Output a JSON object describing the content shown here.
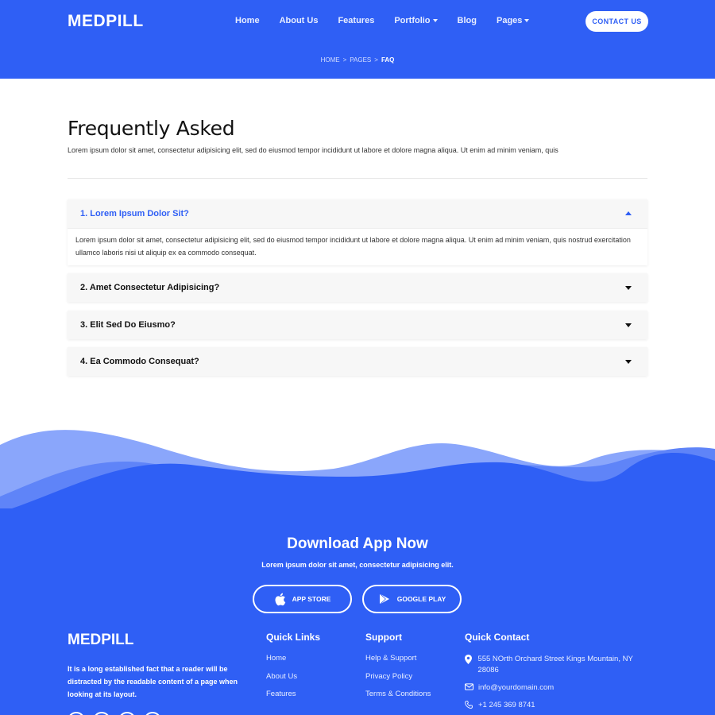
{
  "header": {
    "logo": "MEDPILL",
    "nav": [
      {
        "label": "Home"
      },
      {
        "label": "About Us"
      },
      {
        "label": "Features"
      },
      {
        "label": "Portfolio",
        "dropdown": true
      },
      {
        "label": "Blog"
      },
      {
        "label": "Pages",
        "dropdown": true
      }
    ],
    "contact_label": "CONTACT US",
    "breadcrumb": [
      "HOME",
      "PAGES",
      "FAQ"
    ],
    "breadcrumb_sep": ">"
  },
  "main": {
    "title": "Frequently Asked",
    "lead": "Lorem ipsum dolor sit amet, consectetur adipisicing elit, sed do eiusmod tempor incididunt ut labore et dolore magna aliqua. Ut enim ad minim veniam, quis",
    "faqs": [
      {
        "question": "1. Lorem Ipsum Dolor Sit?",
        "open": true,
        "answer": "Lorem ipsum dolor sit amet, consectetur adipisicing elit, sed do eiusmod tempor incididunt ut labore et dolore magna aliqua. Ut enim ad minim veniam, quis nostrud exercitation ullamco laboris nisi ut aliquip ex ea commodo consequat."
      },
      {
        "question": "2. Amet Consectetur Adipisicing?",
        "open": false
      },
      {
        "question": "3. Elit Sed Do Eiusmo?",
        "open": false
      },
      {
        "question": "4. Ea Commodo Consequat?",
        "open": false
      }
    ]
  },
  "download": {
    "title": "Download App Now",
    "subtitle": "Lorem ipsum dolor sit amet, consectetur adipisicing elit.",
    "app_store": "APP STORE",
    "google_play": "GOOGLE PLAY"
  },
  "footer": {
    "logo": "MEDPILL",
    "about": "It is a long established fact that a reader will be distracted by the readable content of a page when looking at its layout.",
    "quick_links": {
      "title": "Quick Links",
      "items": [
        "Home",
        "About Us",
        "Features"
      ]
    },
    "support": {
      "title": "Support",
      "items": [
        "Help & Support",
        "Privacy Policy",
        "Terms & Conditions"
      ]
    },
    "quick_contact": {
      "title": "Quick Contact",
      "address": "555 NOrth Orchard Street Kings Mountain, NY 28086",
      "email": "info@yourdomain.com",
      "phone": "+1 245 369 8741"
    }
  },
  "colors": {
    "primary": "#2f5ff5",
    "wave_light": "#8aa6fb",
    "wave_mid": "#5f84f8"
  },
  "icons": [
    "apple-icon",
    "google-play-icon",
    "map-pin-icon",
    "envelope-icon",
    "phone-icon",
    "chevron-up-icon",
    "chevron-down-icon"
  ]
}
